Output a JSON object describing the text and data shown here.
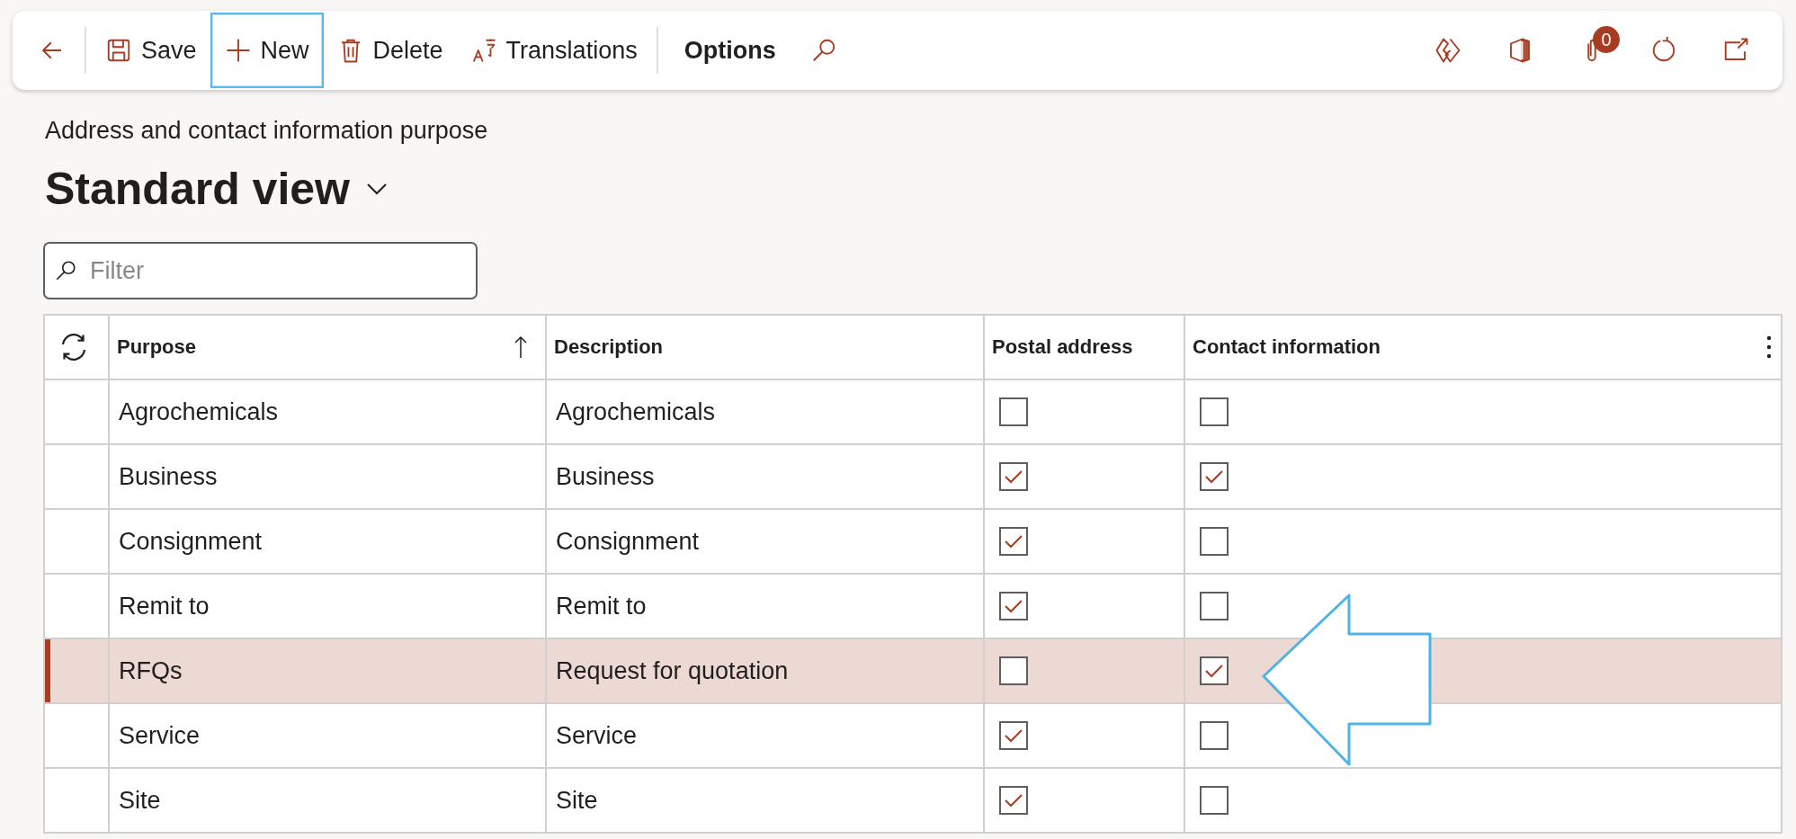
{
  "toolbar": {
    "buttons": [
      {
        "kind": "back"
      },
      {
        "kind": "save",
        "label": "Save",
        "focused": false
      },
      {
        "kind": "new",
        "label": "New",
        "focused": true
      },
      {
        "kind": "delete",
        "label": "Delete",
        "focused": false
      },
      {
        "kind": "translate",
        "label": "Translations",
        "focused": false
      },
      {
        "kind": "options",
        "label": "Options",
        "focused": false
      },
      {
        "kind": "search"
      }
    ],
    "right_icons": [
      {
        "kind": "power-apps"
      },
      {
        "kind": "office"
      },
      {
        "kind": "attachment",
        "badge": "0"
      },
      {
        "kind": "refresh"
      },
      {
        "kind": "popout"
      }
    ]
  },
  "page": {
    "caption": "Address and contact information purpose",
    "view": "Standard view"
  },
  "filter": {
    "placeholder": "Filter"
  },
  "table": {
    "columns": [
      "Purpose",
      "Description",
      "Postal address",
      "Contact information"
    ],
    "rows": [
      {
        "purpose": "Agrochemicals",
        "description": "Agrochemicals",
        "postal_address": false,
        "contact_information": false,
        "selected": false
      },
      {
        "purpose": "Business",
        "description": "Business",
        "postal_address": true,
        "contact_information": true,
        "selected": false
      },
      {
        "purpose": "Consignment",
        "description": "Consignment",
        "postal_address": true,
        "contact_information": false,
        "selected": false
      },
      {
        "purpose": "Remit to",
        "description": "Remit to",
        "postal_address": true,
        "contact_information": false,
        "selected": false
      },
      {
        "purpose": "RFQs",
        "description": "Request for quotation",
        "postal_address": false,
        "contact_information": true,
        "selected": true
      },
      {
        "purpose": "Service",
        "description": "Service",
        "postal_address": true,
        "contact_information": false,
        "selected": false
      },
      {
        "purpose": "Site",
        "description": "Site",
        "postal_address": true,
        "contact_information": false,
        "selected": false
      }
    ]
  },
  "annotation": {
    "kind": "arrow"
  }
}
